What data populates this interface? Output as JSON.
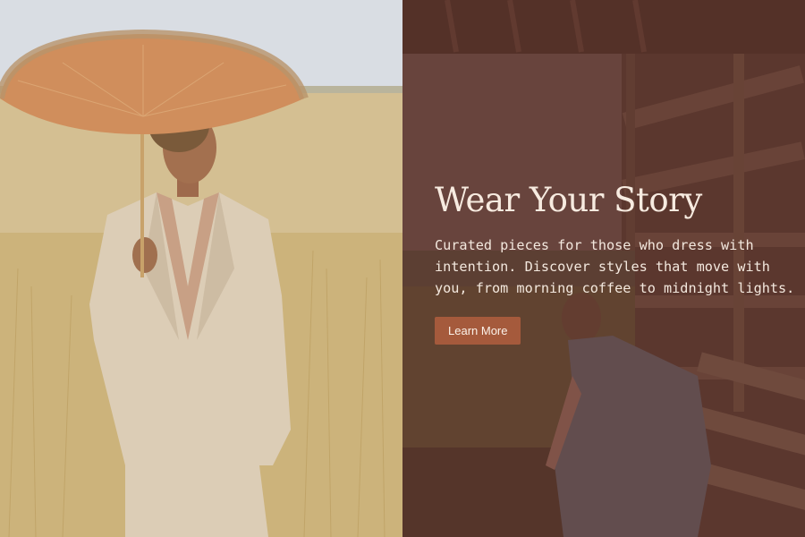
{
  "hero": {
    "title": "Wear Your Story",
    "subtitle": "Curated pieces for those who dress with intention. Discover styles that move with you, from morning coffee to midnight lights.",
    "button_label": "Learn More"
  },
  "colors": {
    "button_bg": "#a55a3c",
    "text": "#f6ece2",
    "overlay": "#5c342c"
  },
  "images": {
    "left": "woman-with-parasol-in-wheat-field",
    "right": "woman-leaning-on-barn-fence"
  }
}
